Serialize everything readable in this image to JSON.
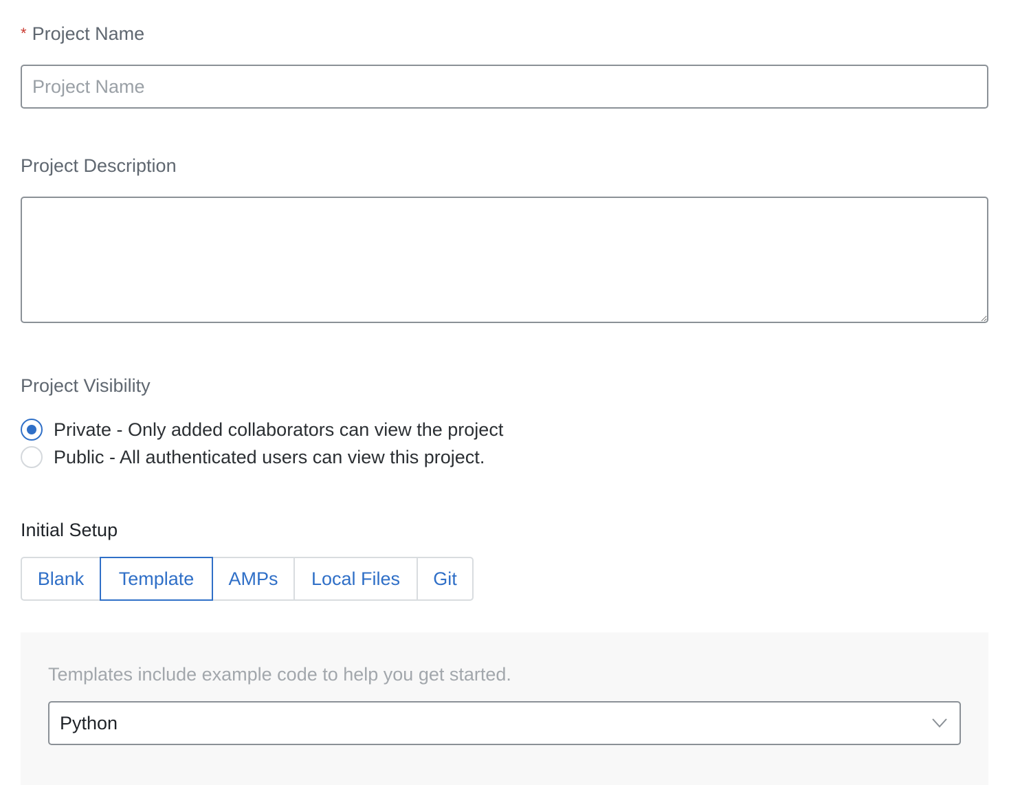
{
  "form": {
    "name": {
      "required_marker": "*",
      "label": "Project Name",
      "placeholder": "Project Name",
      "value": ""
    },
    "description": {
      "label": "Project Description",
      "value": ""
    },
    "visibility": {
      "label": "Project Visibility",
      "options": [
        {
          "label": "Private - Only added collaborators can view the project",
          "selected": true
        },
        {
          "label": "Public - All authenticated users can view this project.",
          "selected": false
        }
      ]
    },
    "initial_setup": {
      "label": "Initial Setup",
      "tabs": [
        {
          "label": "Blank",
          "active": false
        },
        {
          "label": "Template",
          "active": true
        },
        {
          "label": "AMPs",
          "active": false
        },
        {
          "label": "Local Files",
          "active": false
        },
        {
          "label": "Git",
          "active": false
        }
      ],
      "template_hint": "Templates include example code to help you get started.",
      "template_select": {
        "selected": "Python",
        "icon": "chevron-down-icon"
      }
    }
  },
  "colors": {
    "accent": "#2f6fc7",
    "required": "#c9382f",
    "border": "#8a9096",
    "panel_bg": "#f8f8f8"
  }
}
